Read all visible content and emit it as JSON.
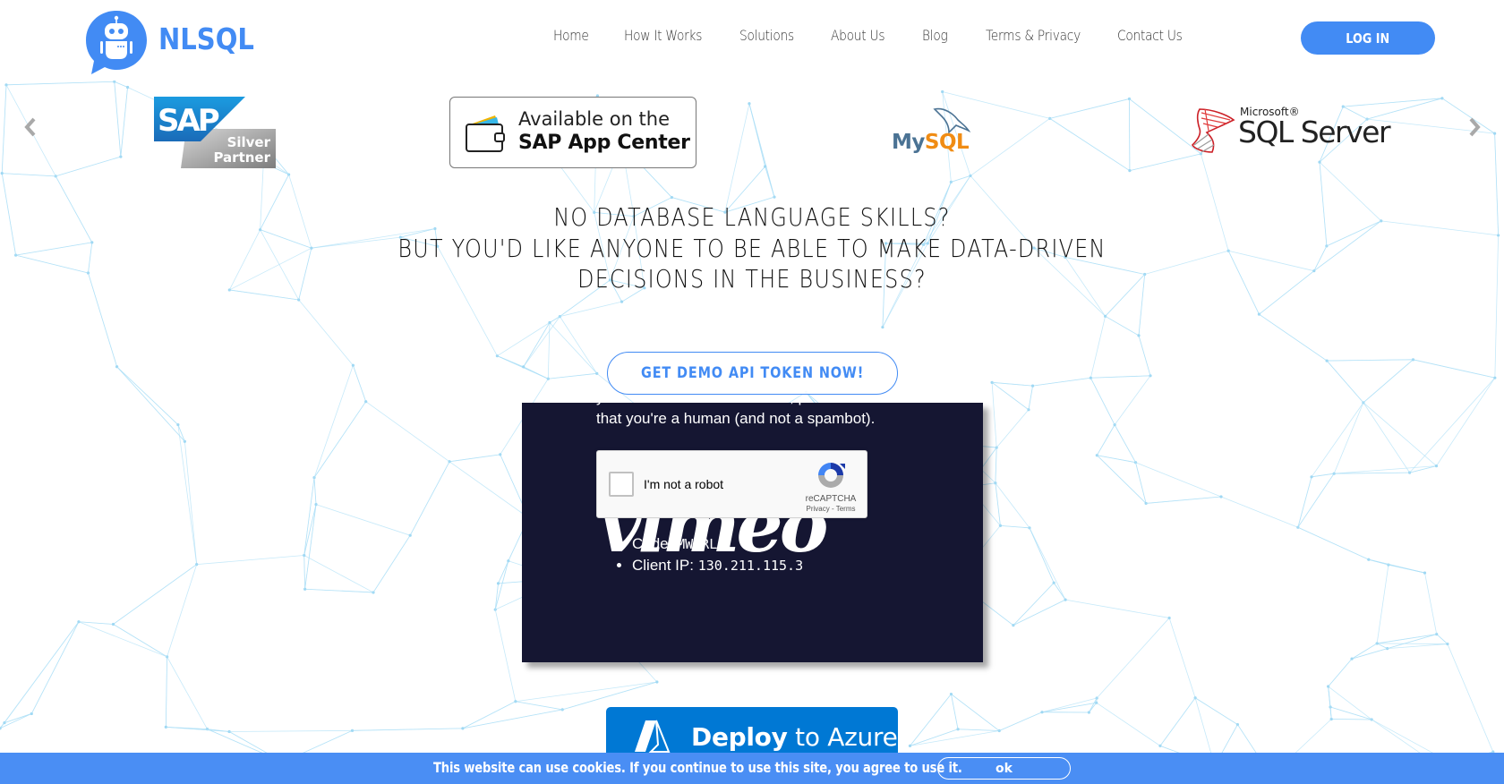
{
  "brand": {
    "name": "NLSQL",
    "color": "#428bf4"
  },
  "nav": {
    "items": [
      {
        "label": "Home"
      },
      {
        "label": "How It Works"
      },
      {
        "label": "Solutions"
      },
      {
        "label": "About Us"
      },
      {
        "label": "Blog"
      },
      {
        "label": "Terms & Privacy"
      },
      {
        "label": "Contact Us"
      }
    ],
    "login_label": "LOG IN"
  },
  "partners": {
    "prev_icon": "chevron-left-icon",
    "next_icon": "chevron-right-icon",
    "logos": [
      {
        "name": "SAP Silver Partner",
        "line1": "SAP",
        "line2": "Silver",
        "line3": "Partner"
      },
      {
        "name": "SAP App Center",
        "line1": "Available on the",
        "line2": "SAP App Center"
      },
      {
        "name": "MySQL",
        "part1": "My",
        "part2": "SQL"
      },
      {
        "name": "Microsoft SQL Server",
        "line1": "Microsoft®",
        "line2": "SQL Server"
      }
    ]
  },
  "hero": {
    "lines": [
      "NO DATABASE LANGUAGE SKILLS?",
      "BUT YOU'D LIKE ANYONE TO BE ABLE TO MAKE DATA-DRIVEN",
      "DECISIONS IN THE BUSINESS?"
    ],
    "cta_label": "GET DEMO API TOKEN NOW!"
  },
  "video_embed": {
    "text_cut": "your connection. To continue, please confirm",
    "text": "that you're a human (and not a spambot).",
    "watermark": "vimeo",
    "recaptcha": {
      "label": "I'm not a robot",
      "brand": "reCAPTCHA",
      "privacy": "Privacy",
      "separator": " - ",
      "terms": "Terms"
    },
    "details": [
      {
        "label": "Code: ",
        "value": "MW-RL"
      },
      {
        "label": "Client IP: ",
        "value": "130.211.115.3"
      }
    ]
  },
  "azure": {
    "bold": "Deploy",
    "rest": " to Azure"
  },
  "cookie": {
    "text": "This website can use cookies. If you continue to use this site, you agree to use it.",
    "ok_label": "ok"
  }
}
